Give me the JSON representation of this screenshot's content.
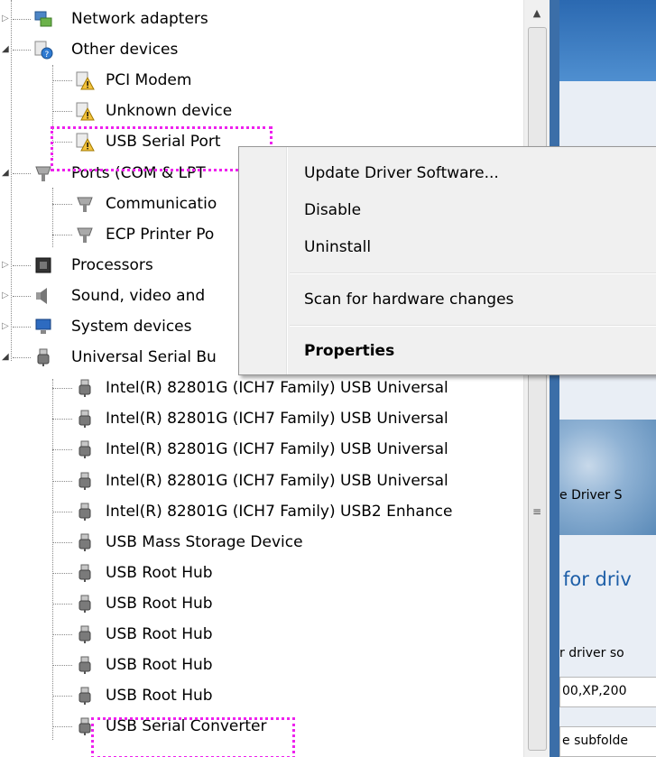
{
  "tree": [
    {
      "label": "Network adapters",
      "icon": "network-adapter-icon",
      "level": 0,
      "expander": "collapsed"
    },
    {
      "label": "Other devices",
      "icon": "unknown-device-category-icon",
      "level": 0,
      "expander": "expanded"
    },
    {
      "label": "PCI Modem",
      "icon": "warning-device-icon",
      "level": 1
    },
    {
      "label": "Unknown device",
      "icon": "warning-device-icon",
      "level": 1
    },
    {
      "label": "USB Serial Port",
      "icon": "warning-device-icon",
      "level": 1,
      "selected": true
    },
    {
      "label": "Ports (COM & LPT",
      "icon": "port-icon",
      "level": 0,
      "expander": "expanded"
    },
    {
      "label": "Communicatio",
      "icon": "port-icon",
      "level": 1
    },
    {
      "label": "ECP Printer Po",
      "icon": "port-icon",
      "level": 1
    },
    {
      "label": "Processors",
      "icon": "processor-icon",
      "level": 0,
      "expander": "collapsed"
    },
    {
      "label": "Sound, video and",
      "icon": "speaker-icon",
      "level": 0,
      "expander": "collapsed"
    },
    {
      "label": "System devices",
      "icon": "system-devices-icon",
      "level": 0,
      "expander": "collapsed"
    },
    {
      "label": "Universal Serial Bu",
      "icon": "usb-plug-icon",
      "level": 0,
      "expander": "expanded"
    },
    {
      "label": "Intel(R) 82801G (ICH7 Family) USB Universal",
      "icon": "usb-plug-icon",
      "level": 1
    },
    {
      "label": "Intel(R) 82801G (ICH7 Family) USB Universal",
      "icon": "usb-plug-icon",
      "level": 1
    },
    {
      "label": "Intel(R) 82801G (ICH7 Family) USB Universal",
      "icon": "usb-plug-icon",
      "level": 1
    },
    {
      "label": "Intel(R) 82801G (ICH7 Family) USB Universal",
      "icon": "usb-plug-icon",
      "level": 1
    },
    {
      "label": "Intel(R) 82801G (ICH7 Family) USB2 Enhance",
      "icon": "usb-plug-icon",
      "level": 1
    },
    {
      "label": "USB Mass Storage Device",
      "icon": "usb-plug-icon",
      "level": 1
    },
    {
      "label": "USB Root Hub",
      "icon": "usb-plug-icon",
      "level": 1
    },
    {
      "label": "USB Root Hub",
      "icon": "usb-plug-icon",
      "level": 1
    },
    {
      "label": "USB Root Hub",
      "icon": "usb-plug-icon",
      "level": 1
    },
    {
      "label": "USB Root Hub",
      "icon": "usb-plug-icon",
      "level": 1
    },
    {
      "label": "USB Root Hub",
      "icon": "usb-plug-icon",
      "level": 1
    },
    {
      "label": "USB Serial Converter",
      "icon": "usb-plug-icon",
      "level": 1
    }
  ],
  "context_menu": {
    "items": [
      {
        "label": "Update Driver Software...",
        "bold": false
      },
      {
        "label": "Disable",
        "bold": false
      },
      {
        "label": "Uninstall",
        "bold": false
      },
      {
        "label": "Scan for hardware changes",
        "bold": false
      },
      {
        "label": "Properties",
        "bold": true
      }
    ]
  },
  "background_window": {
    "banner_text": "e Driver S",
    "heading": "for driv",
    "line1": "r driver so",
    "field_value": "00,XP,200",
    "line3": "e subfolde"
  },
  "colors": {
    "highlight_outline": "#ee22ee",
    "window_frame": "#3b6ea8"
  }
}
